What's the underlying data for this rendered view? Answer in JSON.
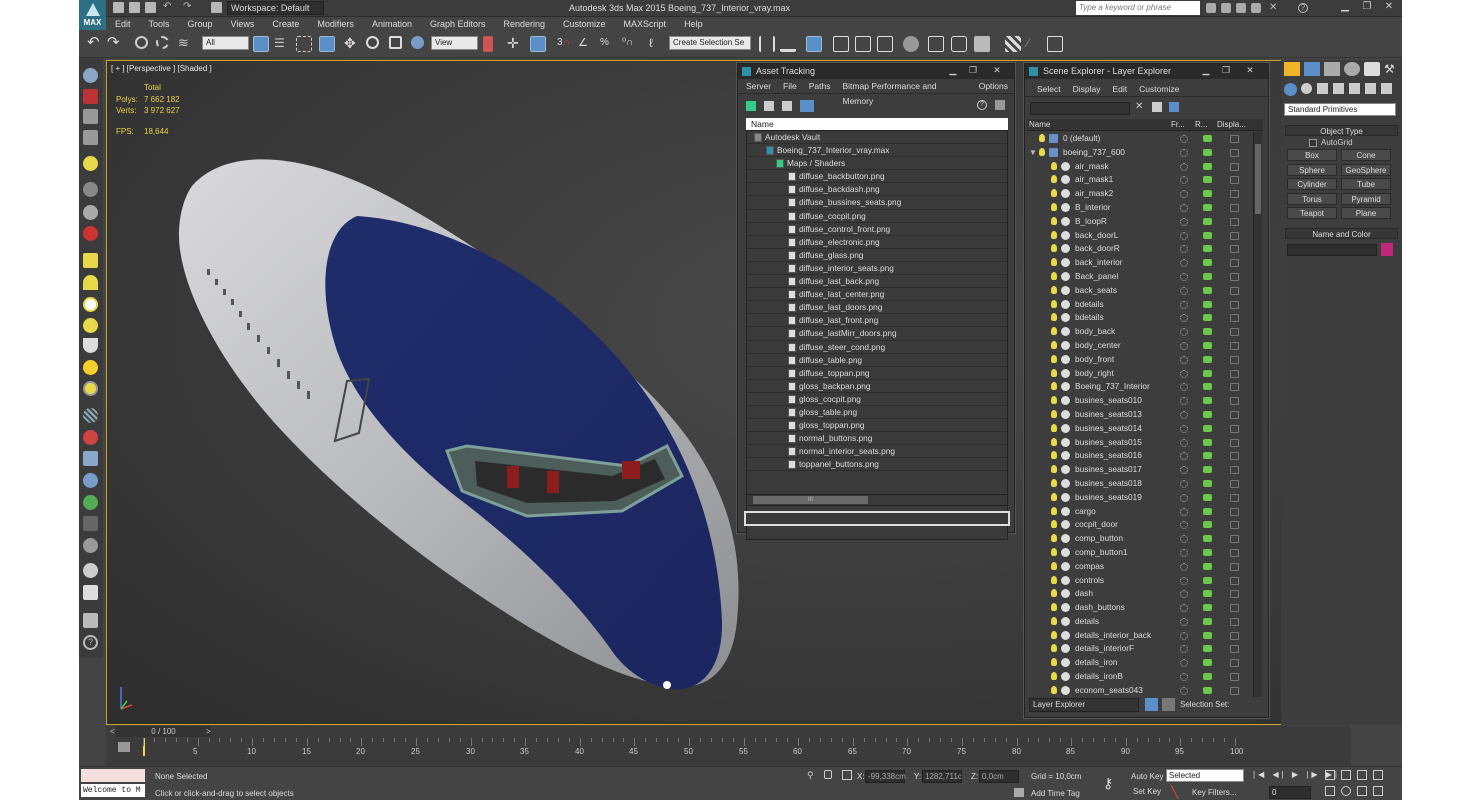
{
  "titlebar": {
    "workspace": "Workspace: Default",
    "app_title": "Autodesk 3ds Max  2015      Boeing_737_Interior_vray.max",
    "search_placeholder": "Type a keyword or phrase",
    "logo": "MAX"
  },
  "menubar": [
    "Edit",
    "Tools",
    "Group",
    "Views",
    "Create",
    "Modifiers",
    "Animation",
    "Graph Editors",
    "Rendering",
    "Customize",
    "MAXScript",
    "Help"
  ],
  "toolbar": {
    "filter_select": "All",
    "ref_coord": "View",
    "named_selection": "Create Selection Se"
  },
  "viewport": {
    "label": "[ + ] [Perspective ] [Shaded ]",
    "stats_header": "Total",
    "polys_label": "Polys:",
    "polys_value": "7 662 182",
    "verts_label": "Verts:",
    "verts_value": "3 972 627",
    "fps_label": "FPS:",
    "fps_value": "18,644"
  },
  "asset_tracking": {
    "title": "Asset Tracking",
    "menu": [
      "Server",
      "File",
      "Paths",
      "Bitmap Performance and Memory",
      "Options"
    ],
    "column": "Name",
    "items": [
      "Autodesk Vault",
      "Boeing_737_Interior_vray.max",
      "Maps / Shaders",
      "diffuse_backbutton.png",
      "diffuse_backdash.png",
      "diffuse_bussines_seats.png",
      "diffuse_cocpit.png",
      "diffuse_control_front.png",
      "diffuse_electronic.png",
      "diffuse_glass.png",
      "diffuse_interior_seats.png",
      "diffuse_last_back.png",
      "diffuse_last_center.png",
      "diffuse_last_doors.png",
      "diffuse_last_front.png",
      "diffuse_lastMirr_doors.png",
      "diffuse_steer_cond.png",
      "diffuse_table.png",
      "diffuse_toppan.png",
      "gloss_backpan.png",
      "gloss_cocpit.png",
      "gloss_table.png",
      "gloss_toppan.png",
      "normal_buttons.png",
      "normal_interior_seats.png",
      "toppanel_buttons.png"
    ],
    "scroll_label": "III"
  },
  "scene_explorer": {
    "title": "Scene Explorer - Layer Explorer",
    "menu": [
      "Select",
      "Display",
      "Edit",
      "Customize"
    ],
    "columns": [
      "Name",
      "Fr...",
      "R...",
      "Displa..."
    ],
    "layers": [
      "0 (default)",
      "boeing_737_600"
    ],
    "objects": [
      "air_mask",
      "air_mask1",
      "air_mask2",
      "B_interior",
      "B_loopR",
      "back_doorL",
      "back_doorR",
      "back_interior",
      "Back_panel",
      "back_seats",
      "bdetails",
      "bdetails",
      "body_back",
      "body_center",
      "body_front",
      "body_right",
      "Boeing_737_Interior",
      "busines_seats010",
      "busines_seats013",
      "busines_seats014",
      "busines_seats015",
      "busines_seats016",
      "busines_seats017",
      "busines_seats018",
      "busines_seats019",
      "cargo",
      "cocpit_door",
      "comp_button",
      "comp_button1",
      "compas",
      "controls",
      "dash",
      "dash_buttons",
      "details",
      "details_interior_back",
      "details_interiorF",
      "details_iron",
      "details_ironB",
      "econom_seats043"
    ],
    "footer_select": "Layer Explorer",
    "selection_set": "Selection Set:"
  },
  "command_panel": {
    "category": "Standard Primitives",
    "object_type": "Object Type",
    "autogrid": "AutoGrid",
    "buttons": [
      "Box",
      "Cone",
      "Sphere",
      "GeoSphere",
      "Cylinder",
      "Tube",
      "Torus",
      "Pyramid",
      "Teapot",
      "Plane"
    ],
    "name_color": "Name and Color",
    "object_color": "#c0287a"
  },
  "timeline": {
    "frame": "0 / 100",
    "ticks": [
      "0",
      "5",
      "10",
      "15",
      "20",
      "25",
      "30",
      "35",
      "40",
      "45",
      "50",
      "55",
      "60",
      "65",
      "70",
      "75",
      "80",
      "85",
      "90",
      "95",
      "100"
    ]
  },
  "status": {
    "maxscript": "Welcome to M",
    "selection": "None Selected",
    "prompt": "Click or click-and-drag to select objects",
    "x_label": "X:",
    "x_value": "-99,338cm",
    "y_label": "Y:",
    "y_value": "1282,711c",
    "z_label": "Z:",
    "z_value": "0,0cm",
    "grid": "Grid = 10,0cm",
    "add_time_tag": "Add Time Tag",
    "auto_key": "Auto Key",
    "set_key": "Set Key",
    "selected": "Selected",
    "key_filters": "Key Filters...",
    "frame_value": "0"
  }
}
